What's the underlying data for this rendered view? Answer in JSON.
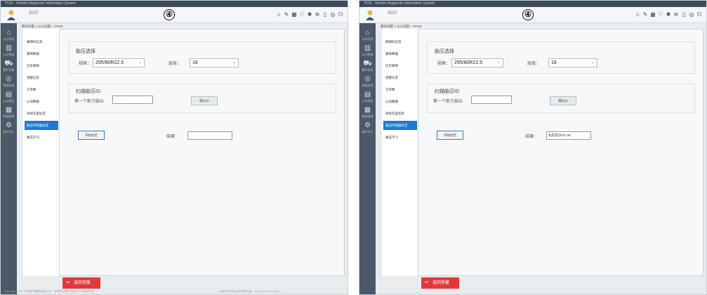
{
  "screens": [
    {
      "window_title": "TCIS - Vehicle Diagnostic Information System",
      "user": "S237",
      "marker": "④",
      "breadcrumb": "整改测量 > 以诊测量 > TPMS",
      "sidebar": [
        {
          "icon": "home-icon",
          "glyph": "⌂",
          "label": "以诊检测"
        },
        {
          "icon": "chart-icon",
          "glyph": "▥",
          "label": "以诊数据"
        },
        {
          "icon": "car-icon",
          "glyph": "⛟",
          "label": "整车检查"
        },
        {
          "icon": "location-icon",
          "glyph": "◎",
          "label": "数据处理"
        },
        {
          "icon": "document-icon",
          "glyph": "▤",
          "label": "以诊报告"
        },
        {
          "icon": "form-icon",
          "glyph": "▦",
          "label": "数据管理"
        },
        {
          "icon": "settings-icon",
          "glyph": "⚙",
          "label": "维护中心"
        }
      ],
      "submenu": [
        "故障码信息",
        "故障数据",
        "历史故障",
        "测量信息",
        "写参数",
        "以动数据",
        "测试车型标定",
        "胎压传感器标定",
        "胎压学习"
      ],
      "submenu_active": 7,
      "section1_title": "胎压选择",
      "spec_label": "规格：",
      "spec_value": "295/80R22.5",
      "ply_label": "层级：",
      "ply_value": "18",
      "section2_title": "扫描胎压ID",
      "tire_label": "第一个新方胎ID",
      "tire_value": "",
      "confirm_btn": "确认ID",
      "start_btn": "开始标定",
      "result_label": "结果：",
      "result_value": "",
      "return_btn": "返回测量",
      "footer_left": "Copyright 2020 中国重汽集团有限公司 · 济南豪沃客车有限公司 版权所有",
      "footer_right": "已成功完成胎压传感器标定 · 2020-10-19 10:28:41"
    },
    {
      "window_title": "TCIS - Vehicle Diagnostic Information System",
      "user": "S237",
      "marker": "④",
      "breadcrumb": "整改测量 > 以诊测量 > TPMS",
      "sidebar": [
        {
          "icon": "home-icon",
          "glyph": "⌂",
          "label": "以诊检测"
        },
        {
          "icon": "chart-icon",
          "glyph": "▥",
          "label": "以诊数据"
        },
        {
          "icon": "car-icon",
          "glyph": "⛟",
          "label": "整车检查"
        },
        {
          "icon": "location-icon",
          "glyph": "◎",
          "label": "数据处理"
        },
        {
          "icon": "document-icon",
          "glyph": "▤",
          "label": "以诊报告"
        },
        {
          "icon": "form-icon",
          "glyph": "▦",
          "label": "数据管理"
        },
        {
          "icon": "settings-icon",
          "glyph": "⚙",
          "label": "维护中心"
        }
      ],
      "submenu": [
        "故障码信息",
        "故障数据",
        "历史故障",
        "测量信息",
        "写参数",
        "以动数据",
        "测试车型标定",
        "胎压传感器标定",
        "胎压学习"
      ],
      "submenu_active": 7,
      "section1_title": "胎压选择",
      "spec_label": "规格：",
      "spec_value": "295/80R22.5",
      "ply_label": "层级：",
      "ply_value": "18",
      "section2_title": "扫描胎压ID",
      "tire_label": "第一个新方胎ID",
      "tire_value": "",
      "confirm_btn": "确认ID",
      "start_btn": "开始标定",
      "result_label": "结果：",
      "result_value": "标定成功OK OK",
      "return_btn": "返回测量",
      "footer_left": "",
      "footer_right": ""
    }
  ],
  "header_icons": [
    {
      "name": "home-icon",
      "glyph": "⌂"
    },
    {
      "name": "wrench-icon",
      "glyph": "✎"
    },
    {
      "name": "grid-icon",
      "glyph": "▦"
    },
    {
      "name": "heart-icon",
      "glyph": "♡"
    },
    {
      "name": "star-icon",
      "glyph": "✱"
    },
    {
      "name": "wifi-icon",
      "glyph": "≋"
    },
    {
      "name": "battery-icon",
      "glyph": "▯"
    },
    {
      "name": "info-icon",
      "glyph": "◎"
    },
    {
      "name": "power-icon",
      "glyph": "⏻"
    }
  ],
  "colors": {
    "accent": "#1a7bd0",
    "danger": "#e5373b",
    "sidebar": "#4a5868"
  }
}
